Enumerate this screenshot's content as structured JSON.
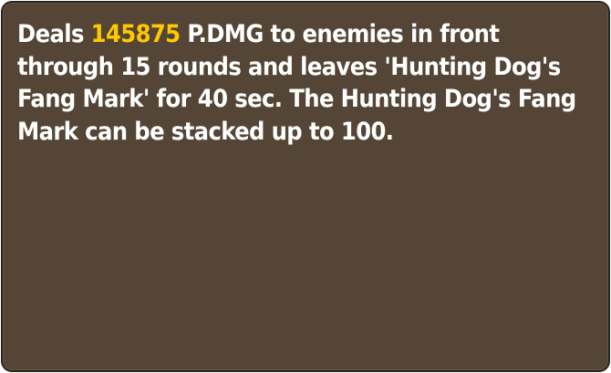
{
  "tooltip": {
    "description_prefix": "Deals ",
    "damage_value": "145875",
    "description_suffix": " P.DMG to enemies in front through 15 rounds and leaves 'Hunting Dog's Fang Mark' for 40 sec. The Hunting Dog's Fang Mark can be stacked up to 100.",
    "colors": {
      "background": "#544536",
      "border": "#2c251d",
      "text": "#ffffff",
      "highlight": "#ffc800"
    }
  }
}
